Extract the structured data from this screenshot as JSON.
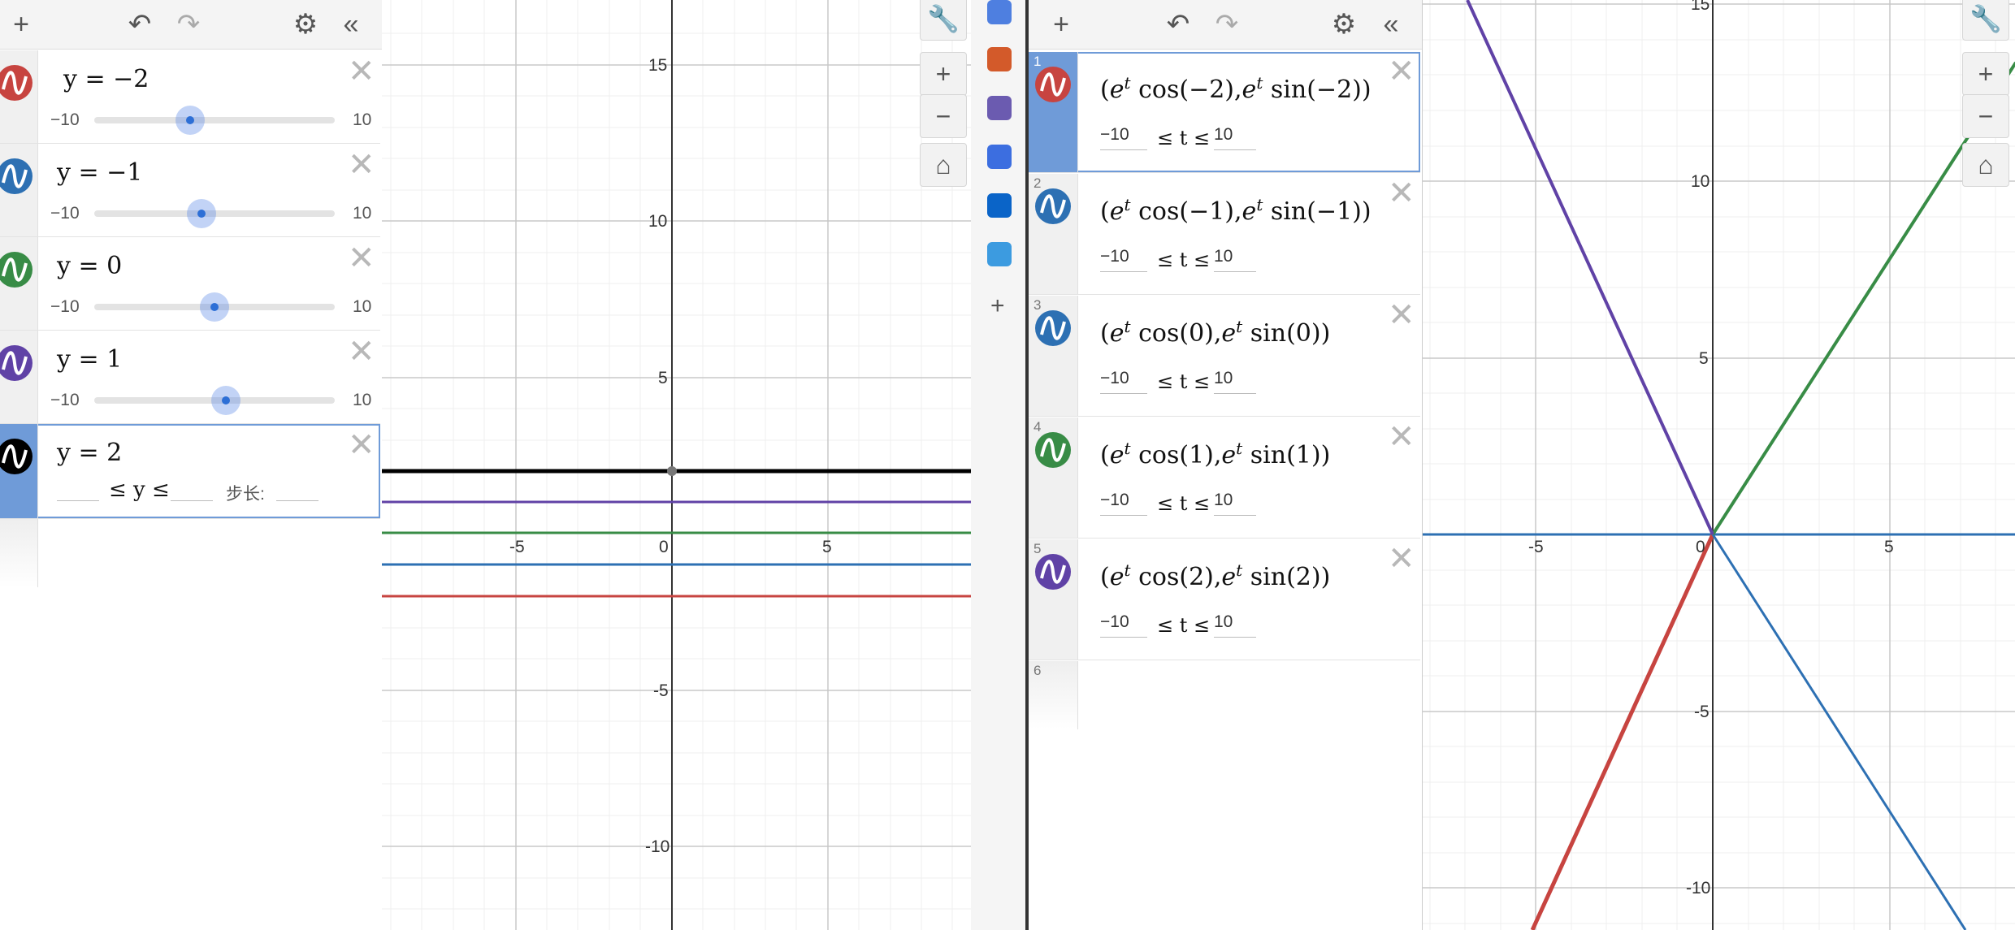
{
  "left": {
    "toolbar": {
      "add": "+",
      "undo": "↶",
      "redo": "↷",
      "settings": "⚙",
      "collapse": "«"
    },
    "expressions": [
      {
        "n": "1",
        "formula": "y = −2",
        "min": "−10",
        "max": "10",
        "color": "#c74440",
        "value": -2
      },
      {
        "n": "2",
        "formula": "y = −1",
        "min": "−10",
        "max": "10",
        "color": "#2d70b3",
        "value": -1
      },
      {
        "n": "3",
        "formula": "y = 0",
        "min": "−10",
        "max": "10",
        "color": "#388c46",
        "value": 0
      },
      {
        "n": "4",
        "formula": "y = 1",
        "min": "−10",
        "max": "10",
        "color": "#6042a6",
        "value": 1
      },
      {
        "n": "5",
        "formula": "y = 2",
        "le1": "≤ y ≤",
        "step": "步长:",
        "color": "#000000"
      }
    ],
    "graph_ticks": {
      "x": [
        "-5",
        "0",
        "5"
      ],
      "y": [
        "15",
        "10",
        "5",
        "-5",
        "-10"
      ]
    }
  },
  "right": {
    "toolbar": {
      "add": "+",
      "undo": "↶",
      "redo": "↷",
      "settings": "⚙",
      "collapse": "«"
    },
    "expressions": [
      {
        "n": "1",
        "x_arg": "−2",
        "y_arg": "−2",
        "min": "−10",
        "max": "10",
        "le": "≤ t ≤",
        "color": "#c74440"
      },
      {
        "n": "2",
        "x_arg": "−1",
        "y_arg": "−1",
        "min": "−10",
        "max": "10",
        "le": "≤ t ≤",
        "color": "#2d70b3"
      },
      {
        "n": "3",
        "x_arg": "0",
        "y_arg": "0",
        "min": "−10",
        "max": "10",
        "le": "≤ t ≤",
        "color": "#2d70b3"
      },
      {
        "n": "4",
        "x_arg": "1",
        "y_arg": "1",
        "min": "−10",
        "max": "10",
        "le": "≤ t ≤",
        "color": "#388c46"
      },
      {
        "n": "5",
        "x_arg": "2",
        "y_arg": "2",
        "min": "−10",
        "max": "10",
        "le": "≤ t ≤",
        "color": "#6042a6"
      },
      {
        "n": "6"
      }
    ],
    "graph_ticks": {
      "x": [
        "-5",
        "0",
        "5"
      ],
      "y": [
        "15",
        "10",
        "5",
        "-5",
        "-10"
      ]
    }
  },
  "graph_tools": {
    "wrench": "🔧",
    "zoom_in": "+",
    "zoom_out": "−",
    "home": "⌂"
  },
  "side_strip": {
    "add": "+"
  },
  "text": {
    "cos": "cos",
    "sin": "sin",
    "e": "e",
    "t": "t"
  }
}
